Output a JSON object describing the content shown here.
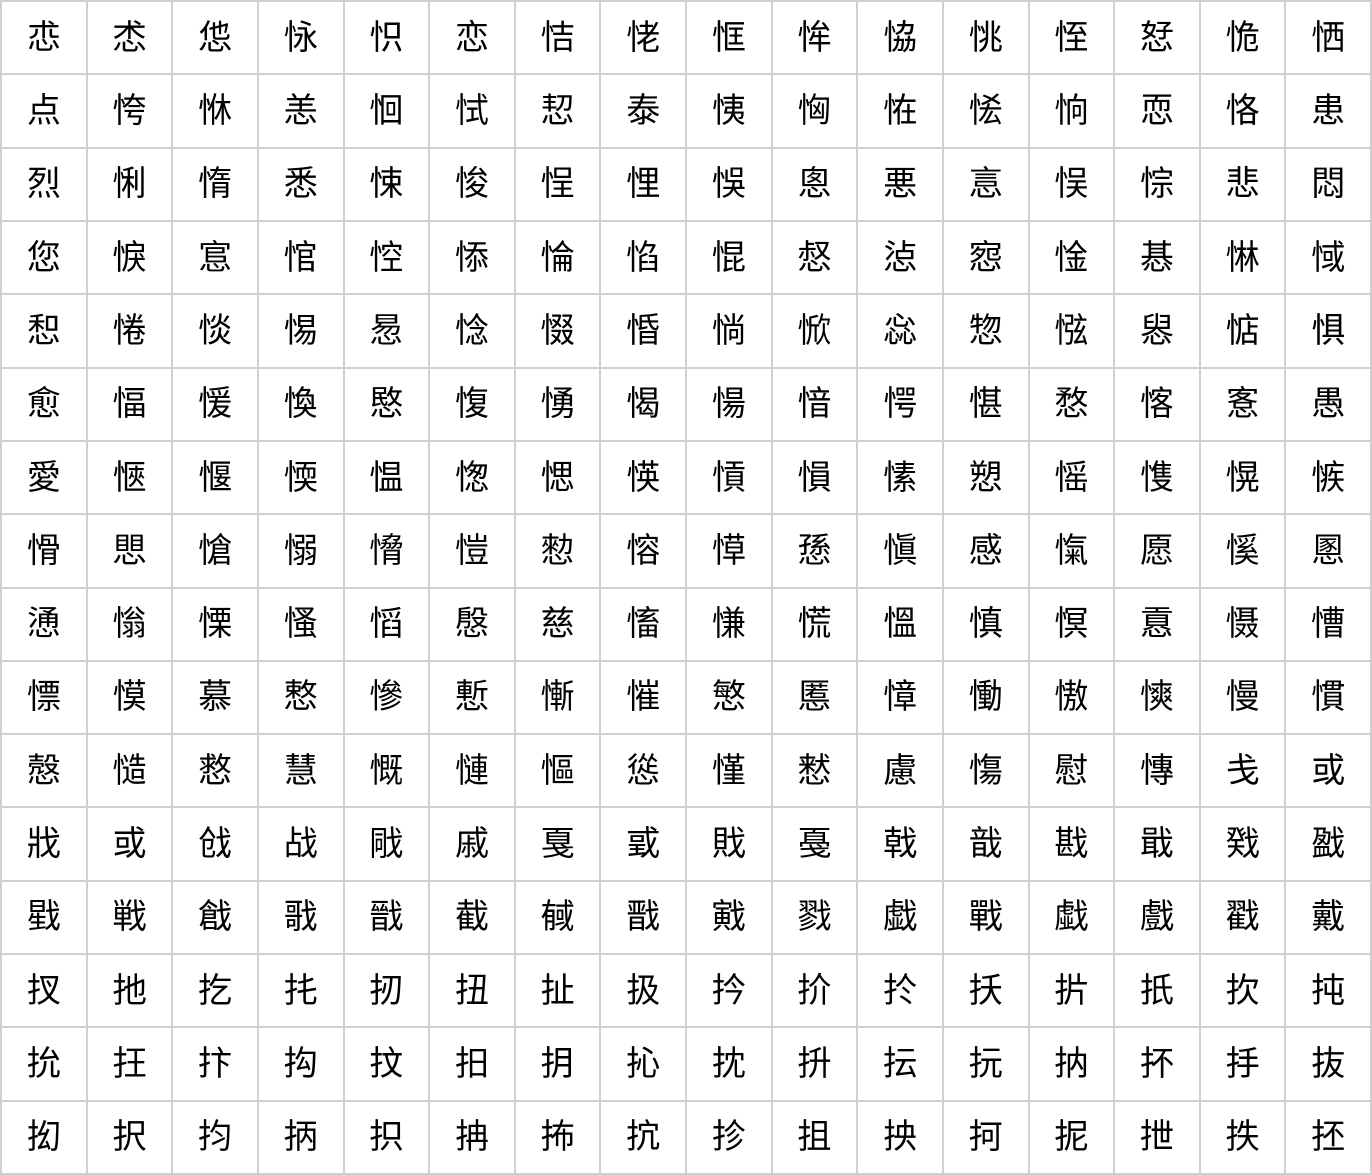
{
  "rows": [
    [
      "怷",
      "怸",
      "怹",
      "怺",
      "怾",
      "恋",
      "恄",
      "恅",
      "恇",
      "恈",
      "恊",
      "恌",
      "恎",
      "恏",
      "恑",
      "恓"
    ],
    [
      "点",
      "恗",
      "恘",
      "恙",
      "恛",
      "恜",
      "恝",
      "泰",
      "恞",
      "恟",
      "恠",
      "恡",
      "恦",
      "恧",
      "恪",
      "患"
    ],
    [
      "烈",
      "悧",
      "惰",
      "悉",
      "悚",
      "悛",
      "悜",
      "悝",
      "悞",
      "悤",
      "悪",
      "悥",
      "悮",
      "悰",
      "悲",
      "悶"
    ],
    [
      "您",
      "悷",
      "悹",
      "悺",
      "悾",
      "悿",
      "惀",
      "惂",
      "惃",
      "惄",
      "惉",
      "惌",
      "惍",
      "惎",
      "惏",
      "惐"
    ],
    [
      "惒",
      "惓",
      "惔",
      "惕",
      "惖",
      "惗",
      "惙",
      "惛",
      "惝",
      "惞",
      "惢",
      "惣",
      "惤",
      "惥",
      "惦",
      "惧"
    ],
    [
      "愈",
      "愊",
      "愋",
      "愌",
      "愍",
      "愎",
      "愑",
      "愒",
      "愓",
      "愔",
      "愕",
      "愖",
      "愗",
      "愘",
      "愙",
      "愚"
    ],
    [
      "愛",
      "愜",
      "愝",
      "愞",
      "愠",
      "愡",
      "愢",
      "愥",
      "愩",
      "愪",
      "愫",
      "愬",
      "愮",
      "愯",
      "愰",
      "愱"
    ],
    [
      "愲",
      "愳",
      "愴",
      "愵",
      "愶",
      "愷",
      "愸",
      "愹",
      "愺",
      "愻",
      "愼",
      "感",
      "愾",
      "愿",
      "慀",
      "慁"
    ],
    [
      "慂",
      "慃",
      "慄",
      "慅",
      "慆",
      "慇",
      "慈",
      "慉",
      "慊",
      "慌",
      "慍",
      "慎",
      "慏",
      "慐",
      "慑",
      "慒"
    ],
    [
      "慓",
      "慔",
      "慕",
      "慗",
      "慘",
      "慙",
      "慚",
      "慛",
      "慜",
      "慝",
      "慞",
      "慟",
      "慠",
      "慡",
      "慢",
      "慣"
    ],
    [
      "慤",
      "慥",
      "慦",
      "慧",
      "慨",
      "慩",
      "慪",
      "慫",
      "慬",
      "慭",
      "慮",
      "慯",
      "慰",
      "慱",
      "戋",
      "或"
    ],
    [
      "戕",
      "或",
      "戗",
      "战",
      "戙",
      "戚",
      "戛",
      "戜",
      "戝",
      "戞",
      "戟",
      "戠",
      "戡",
      "戢",
      "戣",
      "戤"
    ],
    [
      "戥",
      "戦",
      "戧",
      "戨",
      "戩",
      "截",
      "戫",
      "戬",
      "戭",
      "戮",
      "戯",
      "戰",
      "戱",
      "戲",
      "戳",
      "戴"
    ],
    [
      "扠",
      "扡",
      "扢",
      "扥",
      "扨",
      "扭",
      "扯",
      "扱",
      "扲",
      "扴",
      "扵",
      "扷",
      "扸",
      "扺",
      "扻",
      "扽"
    ],
    [
      "抁",
      "抂",
      "抃",
      "抅",
      "抆",
      "抇",
      "抈",
      "抋",
      "抌",
      "抍",
      "抎",
      "抏",
      "抐",
      "抔",
      "抙",
      "抜"
    ],
    [
      "抝",
      "択",
      "抣",
      "抦",
      "抧",
      "抩",
      "抪",
      "抭",
      "抮",
      "抯",
      "抰",
      "抲",
      "抳",
      "抴",
      "抶",
      "抷"
    ]
  ]
}
